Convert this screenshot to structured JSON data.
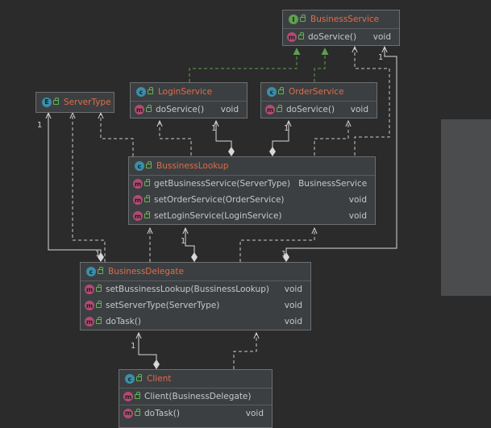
{
  "icons": {
    "class": "c",
    "interface": "I",
    "enum": "E",
    "method": "m"
  },
  "colors": {
    "background": "#2b2b2b",
    "box": "#3c3f41",
    "class_name": "#e06c48",
    "class_icon": "#3b8eaa",
    "interface_icon": "#5fa04e",
    "method_icon": "#b34b72",
    "realization": "#5fa04e"
  },
  "classes": {
    "business_service": {
      "kind": "interface",
      "name": "BusinessService",
      "members": [
        {
          "signature": "doService()",
          "returns": "void"
        }
      ]
    },
    "server_type": {
      "kind": "enum",
      "name": "ServerType",
      "members": []
    },
    "login_service": {
      "kind": "class",
      "name": "LoginService",
      "members": [
        {
          "signature": "doService()",
          "returns": "void"
        }
      ]
    },
    "order_service": {
      "kind": "class",
      "name": "OrderService",
      "members": [
        {
          "signature": "doService()",
          "returns": "void"
        }
      ]
    },
    "business_lookup": {
      "kind": "class",
      "name": "BussinessLookup",
      "members": [
        {
          "signature": "getBusinessService(ServerType)",
          "returns": "BusinessService"
        },
        {
          "signature": "setOrderService(OrderService)",
          "returns": "void"
        },
        {
          "signature": "setLoginService(LoginService)",
          "returns": "void"
        }
      ]
    },
    "business_delegate": {
      "kind": "class",
      "name": "BusinessDelegate",
      "members": [
        {
          "signature": "setBussinessLookup(BussinessLookup)",
          "returns": "void"
        },
        {
          "signature": "setServerType(ServerType)",
          "returns": "void"
        },
        {
          "signature": "doTask()",
          "returns": "void"
        }
      ]
    },
    "client": {
      "kind": "class",
      "name": "Client",
      "members": [
        {
          "signature": "Client(BusinessDelegate)",
          "returns": ""
        },
        {
          "signature": "doTask()",
          "returns": "void"
        }
      ]
    }
  },
  "multiplicities": {
    "lookup_to_service": "1",
    "delegate_to_service": "1",
    "delegate_to_servertype": "1",
    "lookup_to_login": "1",
    "lookup_to_order": "1",
    "delegate_to_lookup": "1",
    "delegate_to_lookup_far": "1",
    "client_to_delegate": "1"
  }
}
